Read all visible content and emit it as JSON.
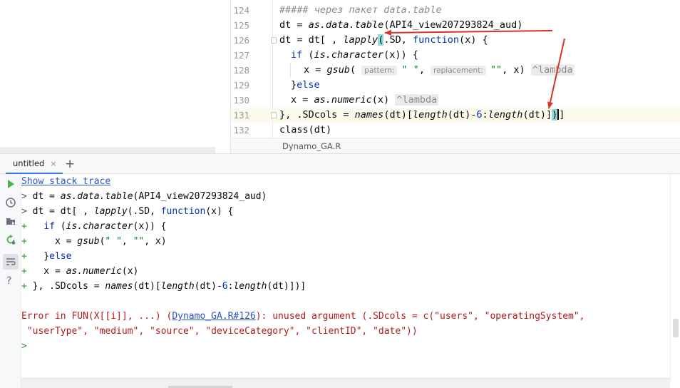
{
  "editor": {
    "file_tab": "Dynamo_GA.R",
    "lines": [
      {
        "num": "124",
        "comment": "##### через пакет data.table"
      },
      {
        "num": "125",
        "a": "dt = ",
        "fn": "as.data.table",
        "b": "(API4_view207293824_aud)"
      },
      {
        "num": "126",
        "a": "dt = dt[ , ",
        "fn": "lapply",
        "brace": "(",
        "b": ".SD, ",
        "kw": "function",
        "c": "(x) {"
      },
      {
        "num": "127",
        "a": "if (",
        "fn": "is.character",
        "b": "(x)) {"
      },
      {
        "num": "128",
        "a": "x = ",
        "fn": "gsub",
        "b": "( ",
        "hint1": "pattern:",
        "s1": "\" \"",
        "c": ", ",
        "hint2": "replacement:",
        "s2": "\"\"",
        "d": ", x) ",
        "lambda": "^lambda"
      },
      {
        "num": "129",
        "a": "}",
        "kw": "else"
      },
      {
        "num": "130",
        "a": "x = ",
        "fn": "as.numeric",
        "b": "(x) ",
        "lambda": "^lambda"
      },
      {
        "num": "131",
        "a": "}, .SDcols = ",
        "fn1": "names",
        "b": "(dt)[",
        "fn2": "length",
        "c": "(dt)-",
        "n": "6",
        "d": ":",
        "fn3": "length",
        "e": "(dt)]",
        "brace": ")",
        "f": "]"
      },
      {
        "num": "132",
        "a": "class(dt)"
      }
    ]
  },
  "console": {
    "tab_label": "untitled",
    "tab_close": "×",
    "add_tab": "+",
    "stack_trace_link": "Show stack trace",
    "prompt": ">",
    "continuation": "+",
    "lines": [
      {
        "a": "dt = ",
        "fn": "as.data.table",
        "b": "(API4_view207293824_aud)"
      },
      {
        "a": "dt = dt[ , ",
        "fn": "lapply",
        "b": "(.SD, ",
        "kw": "function",
        "c": "(x) {"
      },
      {
        "a": "  ",
        "kw": "if",
        "b": " (",
        "fn": "is.character",
        "c": "(x)) {"
      },
      {
        "a": "    x = ",
        "fn": "gsub",
        "b": "(",
        "s1": "\" \"",
        "c": ", ",
        "s2": "\"\"",
        "d": ", x)"
      },
      {
        "a": "  }",
        "kw": "else"
      },
      {
        "a": "  x = ",
        "fn": "as.numeric",
        "b": "(x)"
      },
      {
        "a": "}, .SDcols = ",
        "fn1": "names",
        "b": "(dt)[",
        "fn2": "length",
        "c": "(dt)-",
        "n": "6",
        "d": ":",
        "fn3": "length",
        "e": "(dt)])]"
      }
    ],
    "error_line1_a": "Error in FUN(X[[i]], ...) (",
    "error_link": "Dynamo_GA.R#126",
    "error_line1_b": "): unused argument (.SDcols = c(\"users\", \"operatingSystem\",",
    "error_line2": " \"userType\", \"medium\", \"source\", \"deviceCategory\", \"clientID\", \"date\"))"
  },
  "colors": {
    "keyword": "#0033b3",
    "string": "#067d17",
    "comment": "#8c8c8c",
    "error": "#b31b1b",
    "link": "#2a55c8",
    "annotation_arrow": "#d9342b"
  },
  "icons": [
    "run-icon",
    "history-icon",
    "import-icon",
    "restart-icon",
    "soft-wrap-icon",
    "help-icon"
  ]
}
